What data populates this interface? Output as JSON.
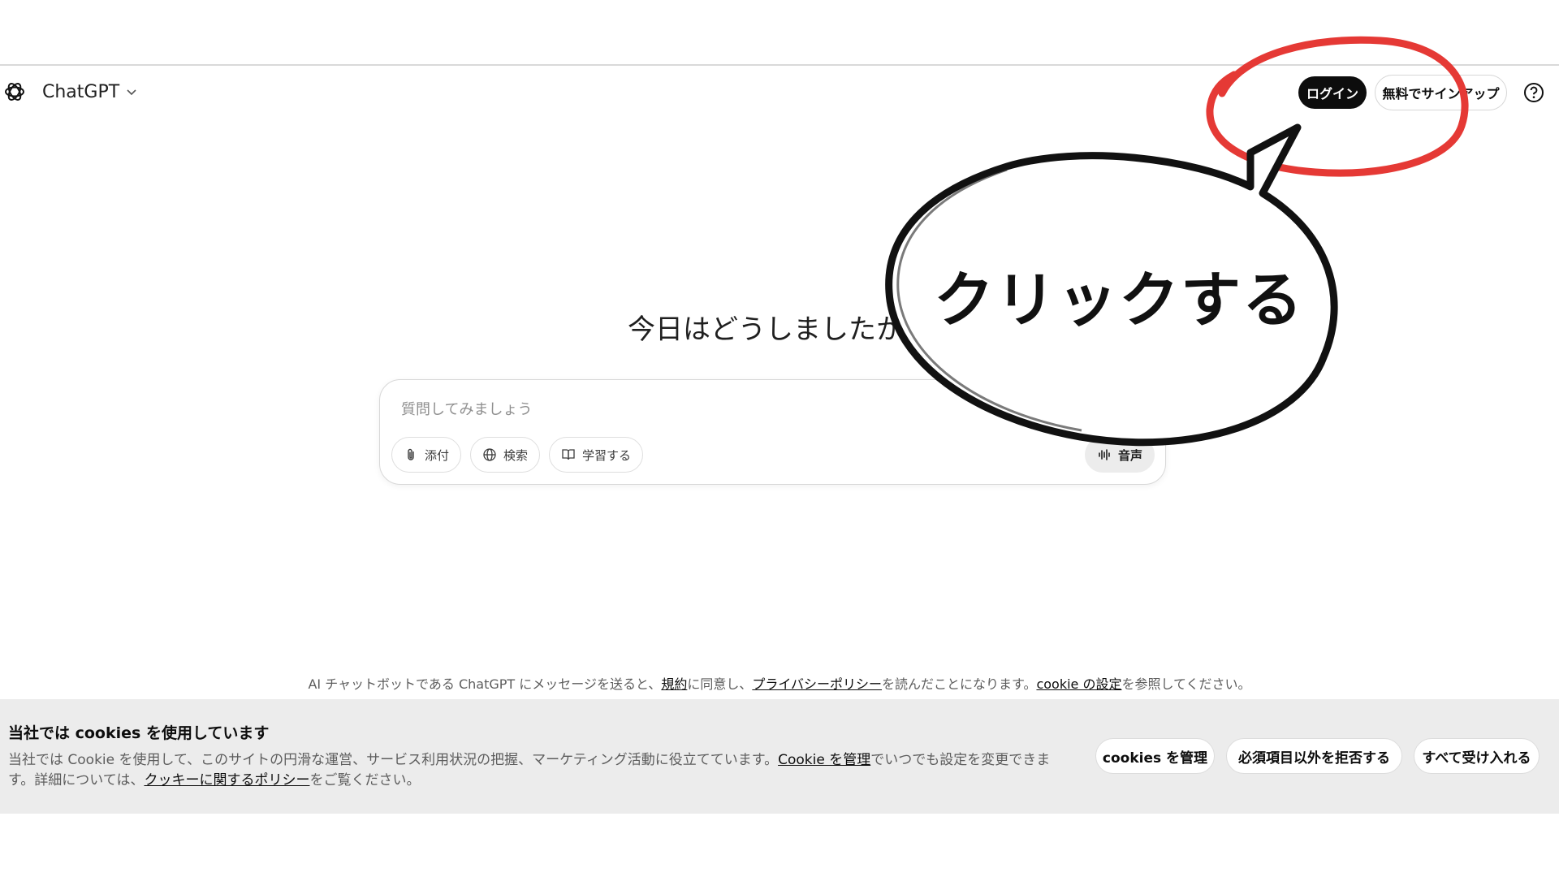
{
  "header": {
    "brand": "ChatGPT",
    "login_label": "ログイン",
    "signup_label": "無料でサインアップ"
  },
  "main": {
    "headline": "今日はどうしましたか？",
    "input_placeholder": "質問してみましょう",
    "chips": {
      "attach": "添付",
      "search": "検索",
      "learn": "学習する",
      "voice": "音声"
    }
  },
  "footer": {
    "part1": "AI チャットボットである ChatGPT にメッセージを送ると、",
    "terms": "規約",
    "part2": "に同意し、",
    "privacy": "プライバシーポリシー",
    "part3": "を読んだことになります。",
    "cookie_settings": "cookie の設定",
    "part4": "を参照してください。"
  },
  "cookie_banner": {
    "title": "当社では cookies を使用しています",
    "body1": "当社では Cookie を使用して、このサイトの円滑な運営、サービス利用状況の把握、マーケティング活動に役立てています。",
    "manage_link": "Cookie を管理",
    "body2": "でいつでも設定を変更できます。詳細については、",
    "policy_link": "クッキーに関するポリシー",
    "body3": "をご覧ください。",
    "manage_button": "cookies を管理",
    "reject_button": "必須項目以外を拒否する",
    "accept_button": "すべて受け入れる"
  },
  "annotation": {
    "bubble_text": "クリックする",
    "circle_color": "#e53935",
    "bubble_stroke": "#111111"
  },
  "icons": [
    "openai-logo-icon",
    "chevron-down-icon",
    "help-icon",
    "paperclip-icon",
    "globe-icon",
    "book-icon",
    "voice-wave-icon"
  ]
}
